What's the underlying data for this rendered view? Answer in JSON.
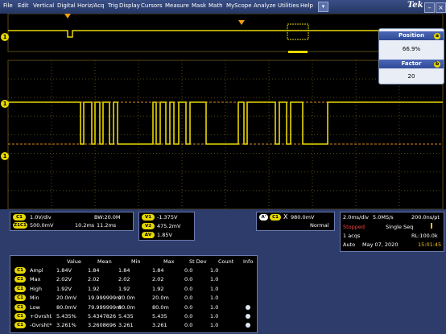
{
  "menu": {
    "items": [
      "File",
      "Edit",
      "Vertical",
      "Digital",
      "Horiz/Acq",
      "Trig",
      "Display",
      "Cursors",
      "Measure",
      "Mask",
      "Math",
      "MyScope",
      "Analyze",
      "Utilities",
      "Help"
    ],
    "logo": "Tek",
    "dropdown_glyph": "▾",
    "minimize_glyph": "–",
    "close_glyph": "×"
  },
  "markers": {
    "channel1_top": "1",
    "channel1_main": "1",
    "channel1_ref": "1",
    "trigger_top": "T",
    "trigger_main": "T"
  },
  "zoom_panel": {
    "position_label": "Position",
    "position_value": "66.9%",
    "position_badge": "a",
    "factor_label": "Factor",
    "factor_value": "20",
    "factor_badge": "b"
  },
  "channels": {
    "ch1_badge": "C1",
    "ch1_scale": "1.0V/div",
    "ch1_bw": "BW:20.0M",
    "z1_badge": "Z1C1",
    "z1_scale": "500.0mV",
    "z1_time": "10.2ms",
    "z1_time2": "11.2ms"
  },
  "cursors": {
    "v1_badge": "V1",
    "v1": "-1.375V",
    "v2_badge": "V2",
    "v2": "475.2mV",
    "dv_badge": "ΔV",
    "dv": "1.85V"
  },
  "trigger": {
    "badge_a": "A'",
    "badge_c1": "C1",
    "level": "980.0mV",
    "mode": "Normal",
    "slope_glyph": "X"
  },
  "acquisition": {
    "timebase": "2.0ms/div",
    "rate": "5.0MS/s",
    "resolution": "200.0ns/pt",
    "status": "Stopped",
    "seq_mode": "Single Seq",
    "acqs": "1 acqs",
    "record_length": "RL:100.0k",
    "auto": "Auto",
    "date": "May 07, 2020",
    "time": "15:01:45"
  },
  "measurements": {
    "headers": [
      "",
      "Value",
      "Mean",
      "Min",
      "Max",
      "St Dev",
      "Count",
      "Info"
    ],
    "rows": [
      {
        "ch": "C1",
        "name": "Ampl",
        "value": "1.84V",
        "mean": "1.84",
        "min": "1.84",
        "max": "1.84",
        "stdev": "0.0",
        "count": "1.0",
        "info": ""
      },
      {
        "ch": "C1",
        "name": "Max",
        "value": "2.02V",
        "mean": "2.02",
        "min": "2.02",
        "max": "2.02",
        "stdev": "0.0",
        "count": "1.0",
        "info": ""
      },
      {
        "ch": "C1",
        "name": "High",
        "value": "1.92V",
        "mean": "1.92",
        "min": "1.92",
        "max": "1.92",
        "stdev": "0.0",
        "count": "1.0",
        "info": ""
      },
      {
        "ch": "C1",
        "name": "Min",
        "value": "20.0mV",
        "mean": "19.999999m",
        "min": "20.0m",
        "max": "20.0m",
        "stdev": "0.0",
        "count": "1.0",
        "info": ""
      },
      {
        "ch": "C1",
        "name": "Low",
        "value": "80.0mV",
        "mean": "79.999999m",
        "min": "80.0m",
        "max": "80.0m",
        "stdev": "0.0",
        "count": "1.0",
        "info": "icon"
      },
      {
        "ch": "C1",
        "name": "+Ovrsht",
        "value": "5.435%",
        "mean": "5.4347826",
        "min": "5.435",
        "max": "5.435",
        "stdev": "0.0",
        "count": "1.0",
        "info": "icon"
      },
      {
        "ch": "C1",
        "name": "-Ovrsht*",
        "value": "3.261%",
        "mean": "3.2608696",
        "min": "3.261",
        "max": "3.261",
        "stdev": "0.0",
        "count": "1.0",
        "info": "icon"
      }
    ]
  },
  "colors": {
    "trace": "#e8d800",
    "grid": "#5a4a12",
    "readout_bg": "#2d3c6a"
  }
}
